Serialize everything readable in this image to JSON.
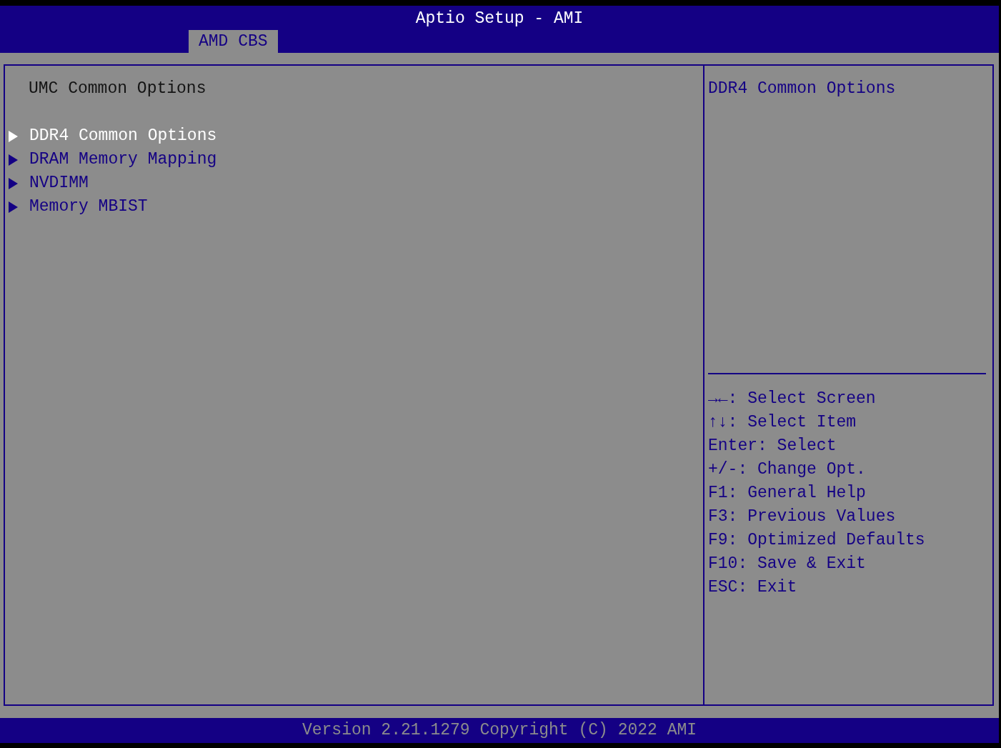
{
  "window": {
    "title": "Aptio Setup - AMI"
  },
  "tabs": [
    {
      "label": "AMD CBS",
      "selected": true
    }
  ],
  "main_panel": {
    "heading": "UMC Common Options",
    "items": [
      {
        "label": "DDR4 Common Options",
        "selected": true
      },
      {
        "label": "DRAM Memory Mapping",
        "selected": false
      },
      {
        "label": "NVDIMM",
        "selected": false
      },
      {
        "label": "Memory MBIST",
        "selected": false
      }
    ]
  },
  "help_panel": {
    "description": "DDR4 Common Options",
    "keys": [
      "→←: Select Screen",
      "↑↓: Select Item",
      "Enter: Select",
      "+/-: Change Opt.",
      "F1: General Help",
      "F3: Previous Values",
      "F9: Optimized Defaults",
      "F10: Save & Exit",
      "ESC: Exit"
    ]
  },
  "status_bar": "Version 2.21.1279 Copyright (C) 2022 AMI"
}
